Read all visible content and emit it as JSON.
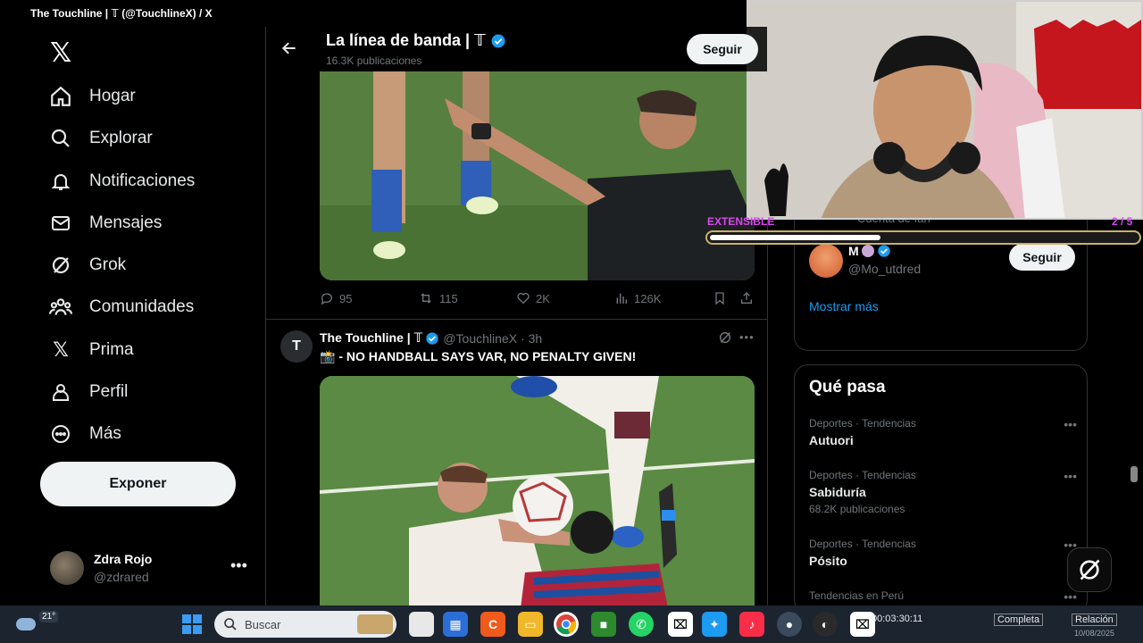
{
  "window": {
    "title": "The Touchline | 𝕋 (@TouchlineX) / X"
  },
  "nav": {
    "items": [
      {
        "label": "Hogar",
        "icon": "home-icon"
      },
      {
        "label": "Explorar",
        "icon": "search-icon"
      },
      {
        "label": "Notificaciones",
        "icon": "bell-icon"
      },
      {
        "label": "Mensajes",
        "icon": "mail-icon"
      },
      {
        "label": "Grok",
        "icon": "grok-icon"
      },
      {
        "label": "Comunidades",
        "icon": "communities-icon"
      },
      {
        "label": "Prima",
        "icon": "x-logo-icon"
      },
      {
        "label": "Perfil",
        "icon": "person-icon"
      },
      {
        "label": "Más",
        "icon": "more-circle-icon"
      }
    ],
    "post_label": "Exponer",
    "user": {
      "name": "Zdra Rojo",
      "handle": "@zdrared"
    }
  },
  "header": {
    "title": "La línea de banda | 𝕋",
    "subtitle": "16.3K publicaciones",
    "follow_label": "Seguir"
  },
  "post1": {
    "replies": "95",
    "reposts": "115",
    "likes": "2K",
    "views": "126K"
  },
  "post2": {
    "avatar_letter": "T",
    "name": "The Touchline | 𝕋",
    "handle": "@TouchlineX",
    "time": "· 3h",
    "text": "📸 - NO HANDBALL SAYS VAR, NO PENALTY GIVEN!"
  },
  "sidebar": {
    "fan_account_label": "Cuenta de fan",
    "suggestion": {
      "name": "M",
      "handle": "@Mo_utdred",
      "follow_label": "Seguir"
    },
    "show_more": "Mostrar más",
    "whats_happening_title": "Qué pasa",
    "trends": [
      {
        "context": "Deportes · Tendencias",
        "title": "Autuori",
        "count": ""
      },
      {
        "context": "Deportes · Tendencias",
        "title": "Sabiduría",
        "count": "68.2K publicaciones"
      },
      {
        "context": "Deportes · Tendencias",
        "title": "Pósito",
        "count": ""
      },
      {
        "context": "Tendencias en Perú",
        "title": "",
        "count": ""
      }
    ]
  },
  "overlay": {
    "label": "EXTENSIBLE",
    "count": "2 / 5",
    "progress_fraction": 0.4
  },
  "taskbar": {
    "temperature": "21°",
    "search_placeholder": "Buscar",
    "timer1": "00:03:30:11",
    "btn_completa": "Completa",
    "btn_relacion": "Relación",
    "date": "10/08/2025"
  }
}
